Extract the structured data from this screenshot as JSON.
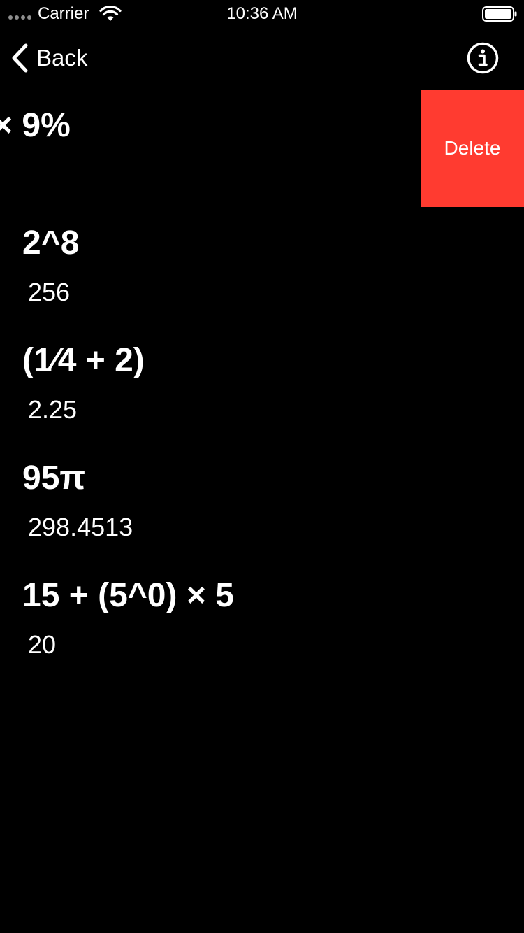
{
  "status_bar": {
    "carrier": "Carrier",
    "time": "10:36 AM",
    "signal_icon": "signal-dots-icon",
    "wifi_icon": "wifi-icon",
    "battery_icon": "battery-icon"
  },
  "nav": {
    "back_label": "Back",
    "back_icon": "chevron-left-icon",
    "info_icon": "info-circle-icon"
  },
  "history": {
    "swiped": {
      "expression": "× 9%",
      "delete_label": "Delete"
    },
    "items": [
      {
        "expression": "2^8",
        "result": "256"
      },
      {
        "expression": "(1⁄4 + 2)",
        "result": "2.25"
      },
      {
        "expression": "95π",
        "result": "298.4513"
      },
      {
        "expression": "15 + (5^0) × 5",
        "result": "20"
      }
    ]
  },
  "colors": {
    "background": "#000000",
    "text": "#ffffff",
    "delete": "#ff3b30"
  }
}
